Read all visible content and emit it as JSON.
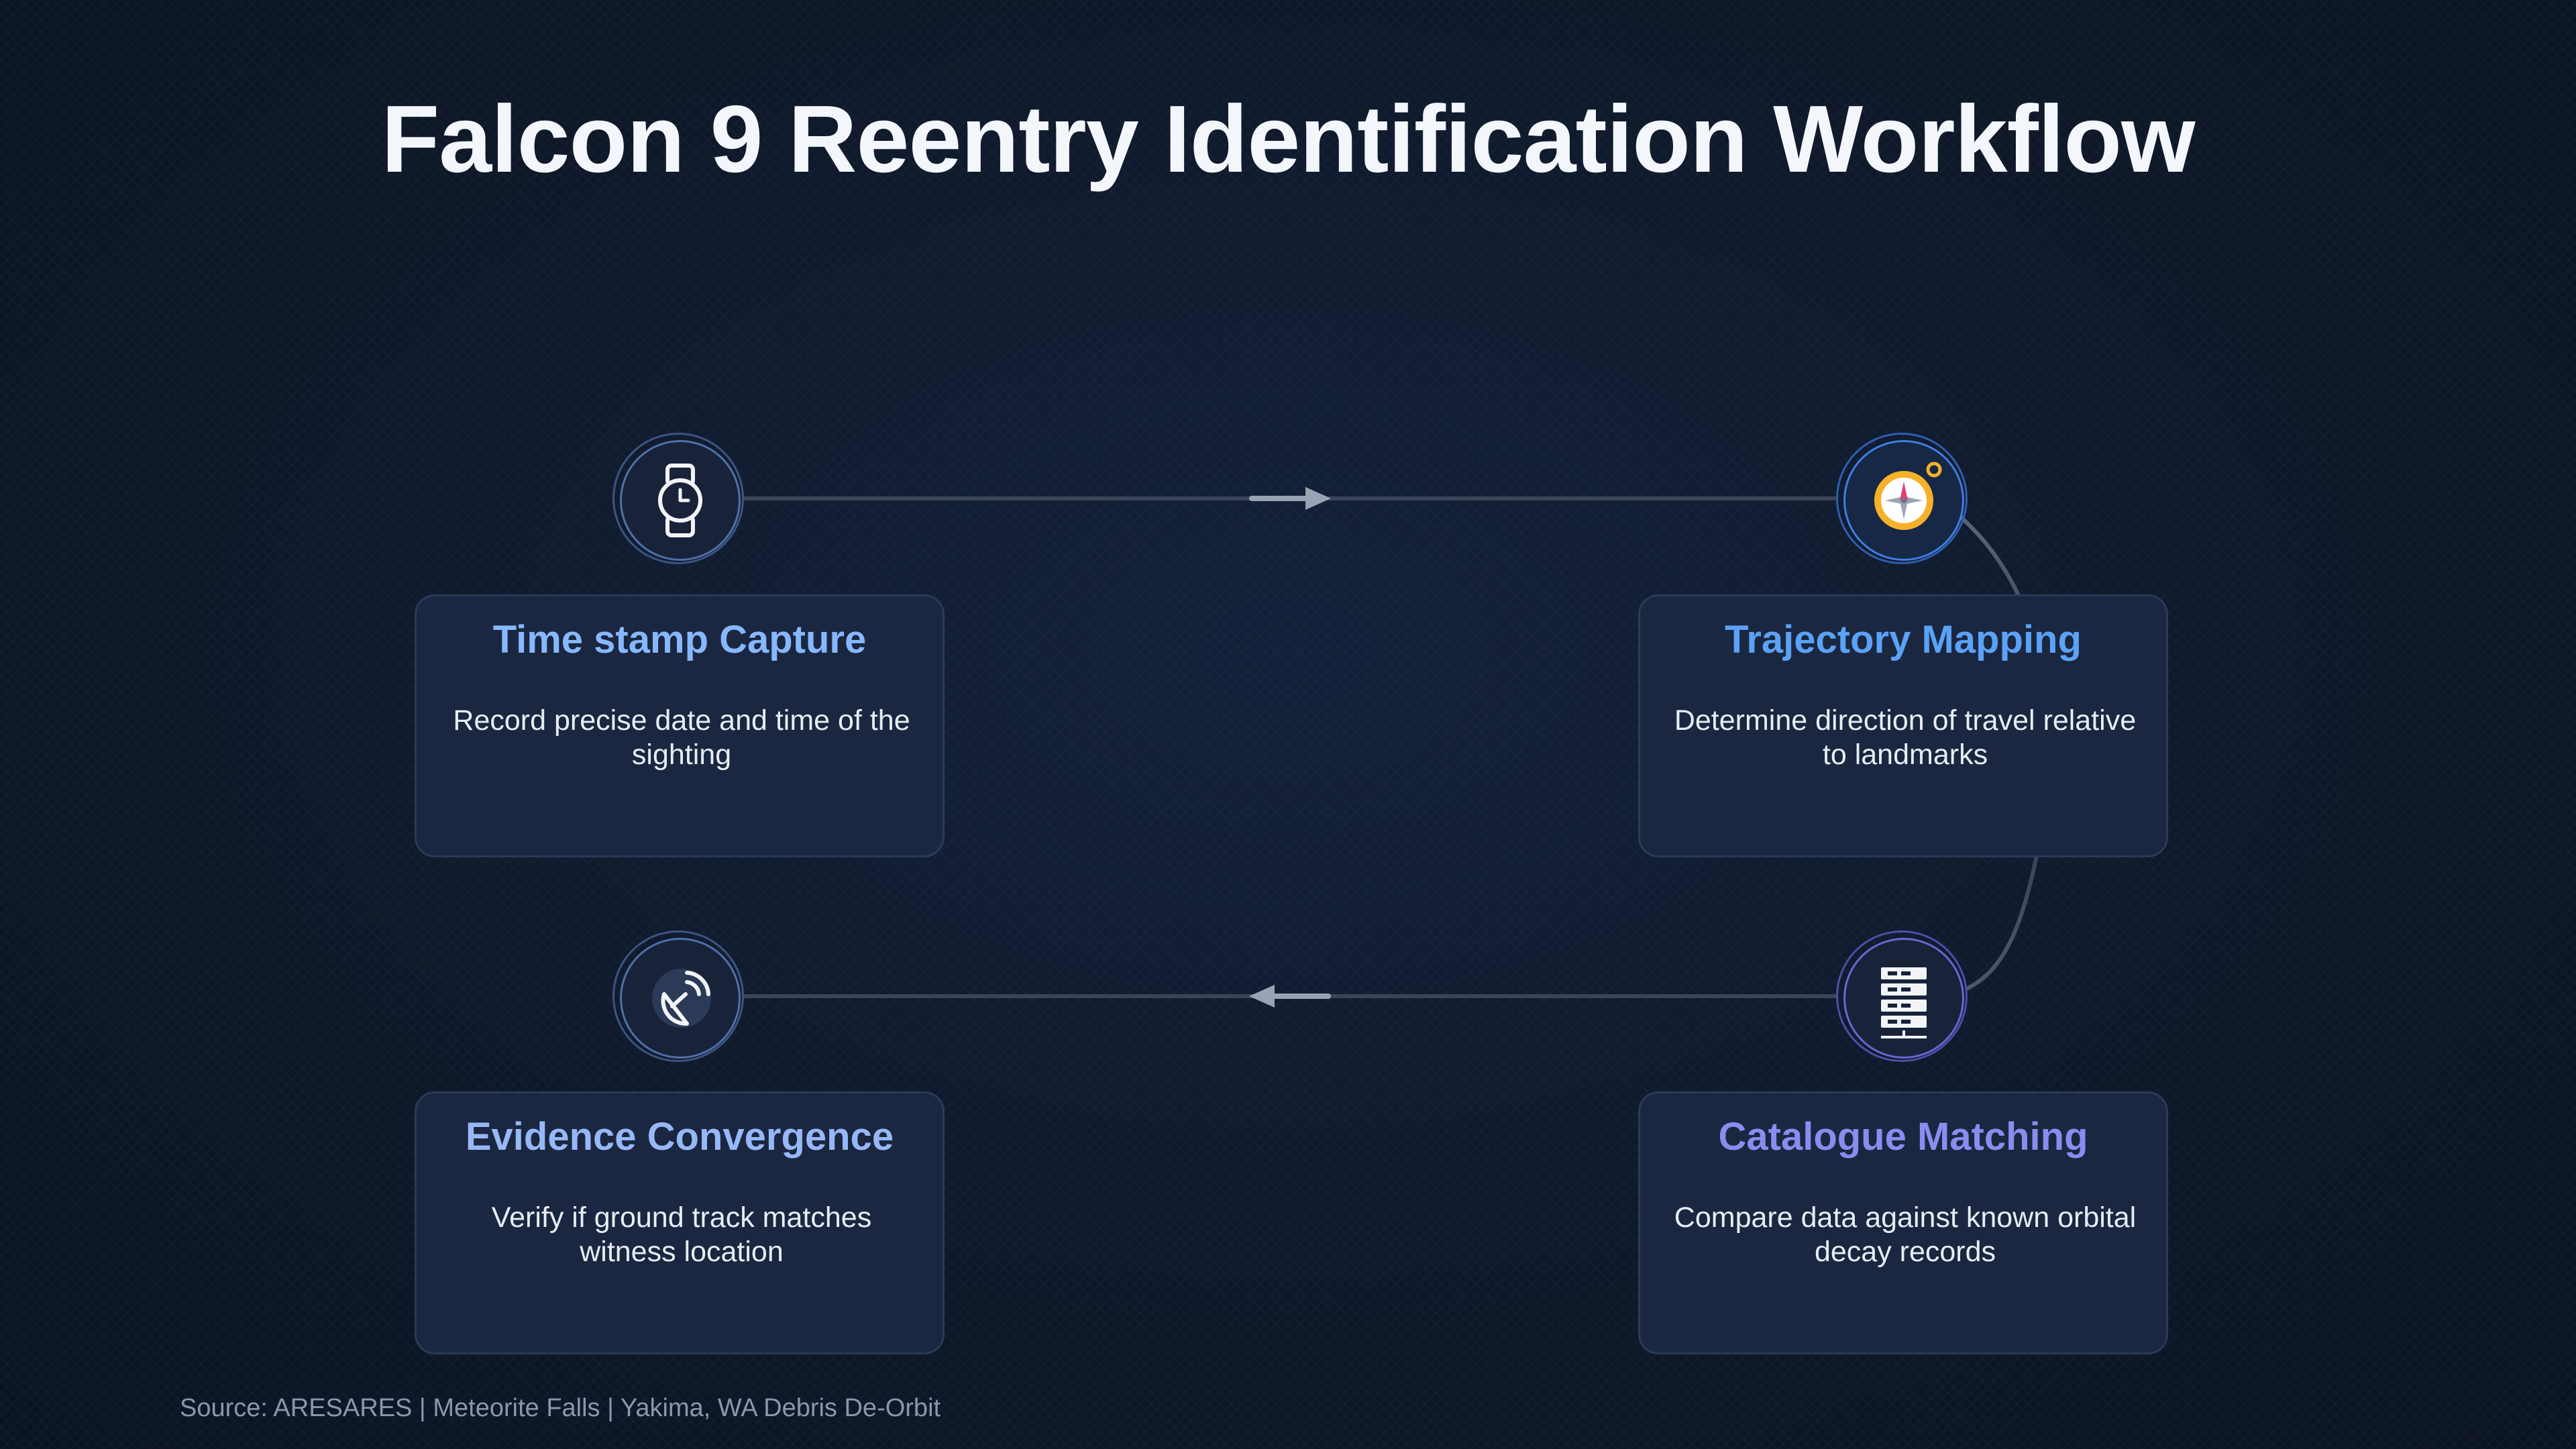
{
  "title": "Falcon 9 Reentry Identification Workflow",
  "steps": [
    {
      "title": "Time stamp Capture",
      "description": "Record precise date and time of the sighting",
      "icon": "watch-icon",
      "color": "#86b8ff"
    },
    {
      "title": "Trajectory Mapping",
      "description": "Determine direction of travel relative to landmarks",
      "icon": "compass-icon",
      "color": "#5aa2f6"
    },
    {
      "title": "Catalogue Matching",
      "description": "Compare data against known orbital decay records",
      "icon": "server-icon",
      "color": "#8a8cf0"
    },
    {
      "title": "Evidence Convergence",
      "description": "Verify if ground track matches witness location",
      "icon": "satellite-dish-icon",
      "color": "#97b8f7"
    }
  ],
  "source": "Source: ARESARES | Meteorite Falls | Yakima, WA Debris De-Orbit"
}
